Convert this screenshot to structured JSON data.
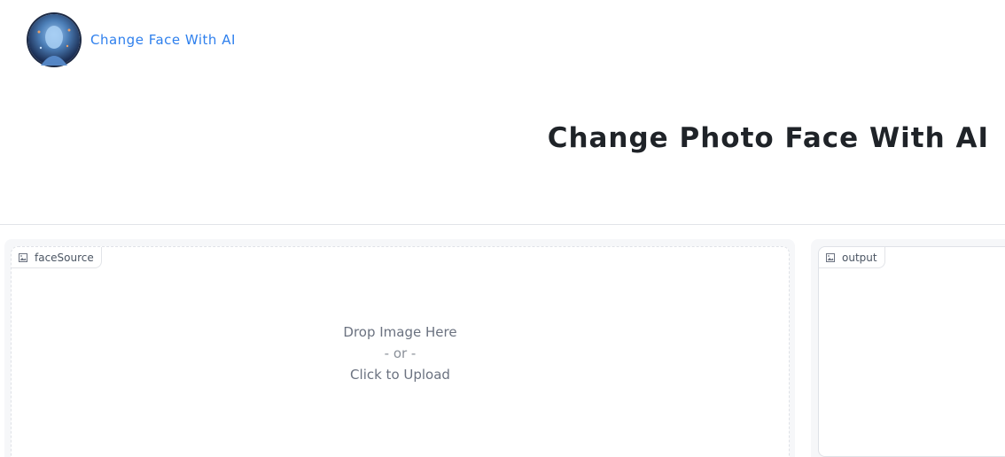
{
  "header": {
    "brand_text": "Change Face With AI",
    "avatar_icon": "ai-face-avatar-icon"
  },
  "main": {
    "title": "Change Photo Face With AI"
  },
  "face_source": {
    "label": "faceSource",
    "icon": "image-icon",
    "drop_line1": "Drop Image Here",
    "drop_line2": "- or -",
    "drop_line3": "Click to Upload"
  },
  "output": {
    "label": "output",
    "icon": "image-icon"
  },
  "colors": {
    "brand_link": "#2f80ed",
    "title_text": "#1f2328",
    "panel_bg": "#f6f7f9",
    "border": "#e2e4e8"
  }
}
